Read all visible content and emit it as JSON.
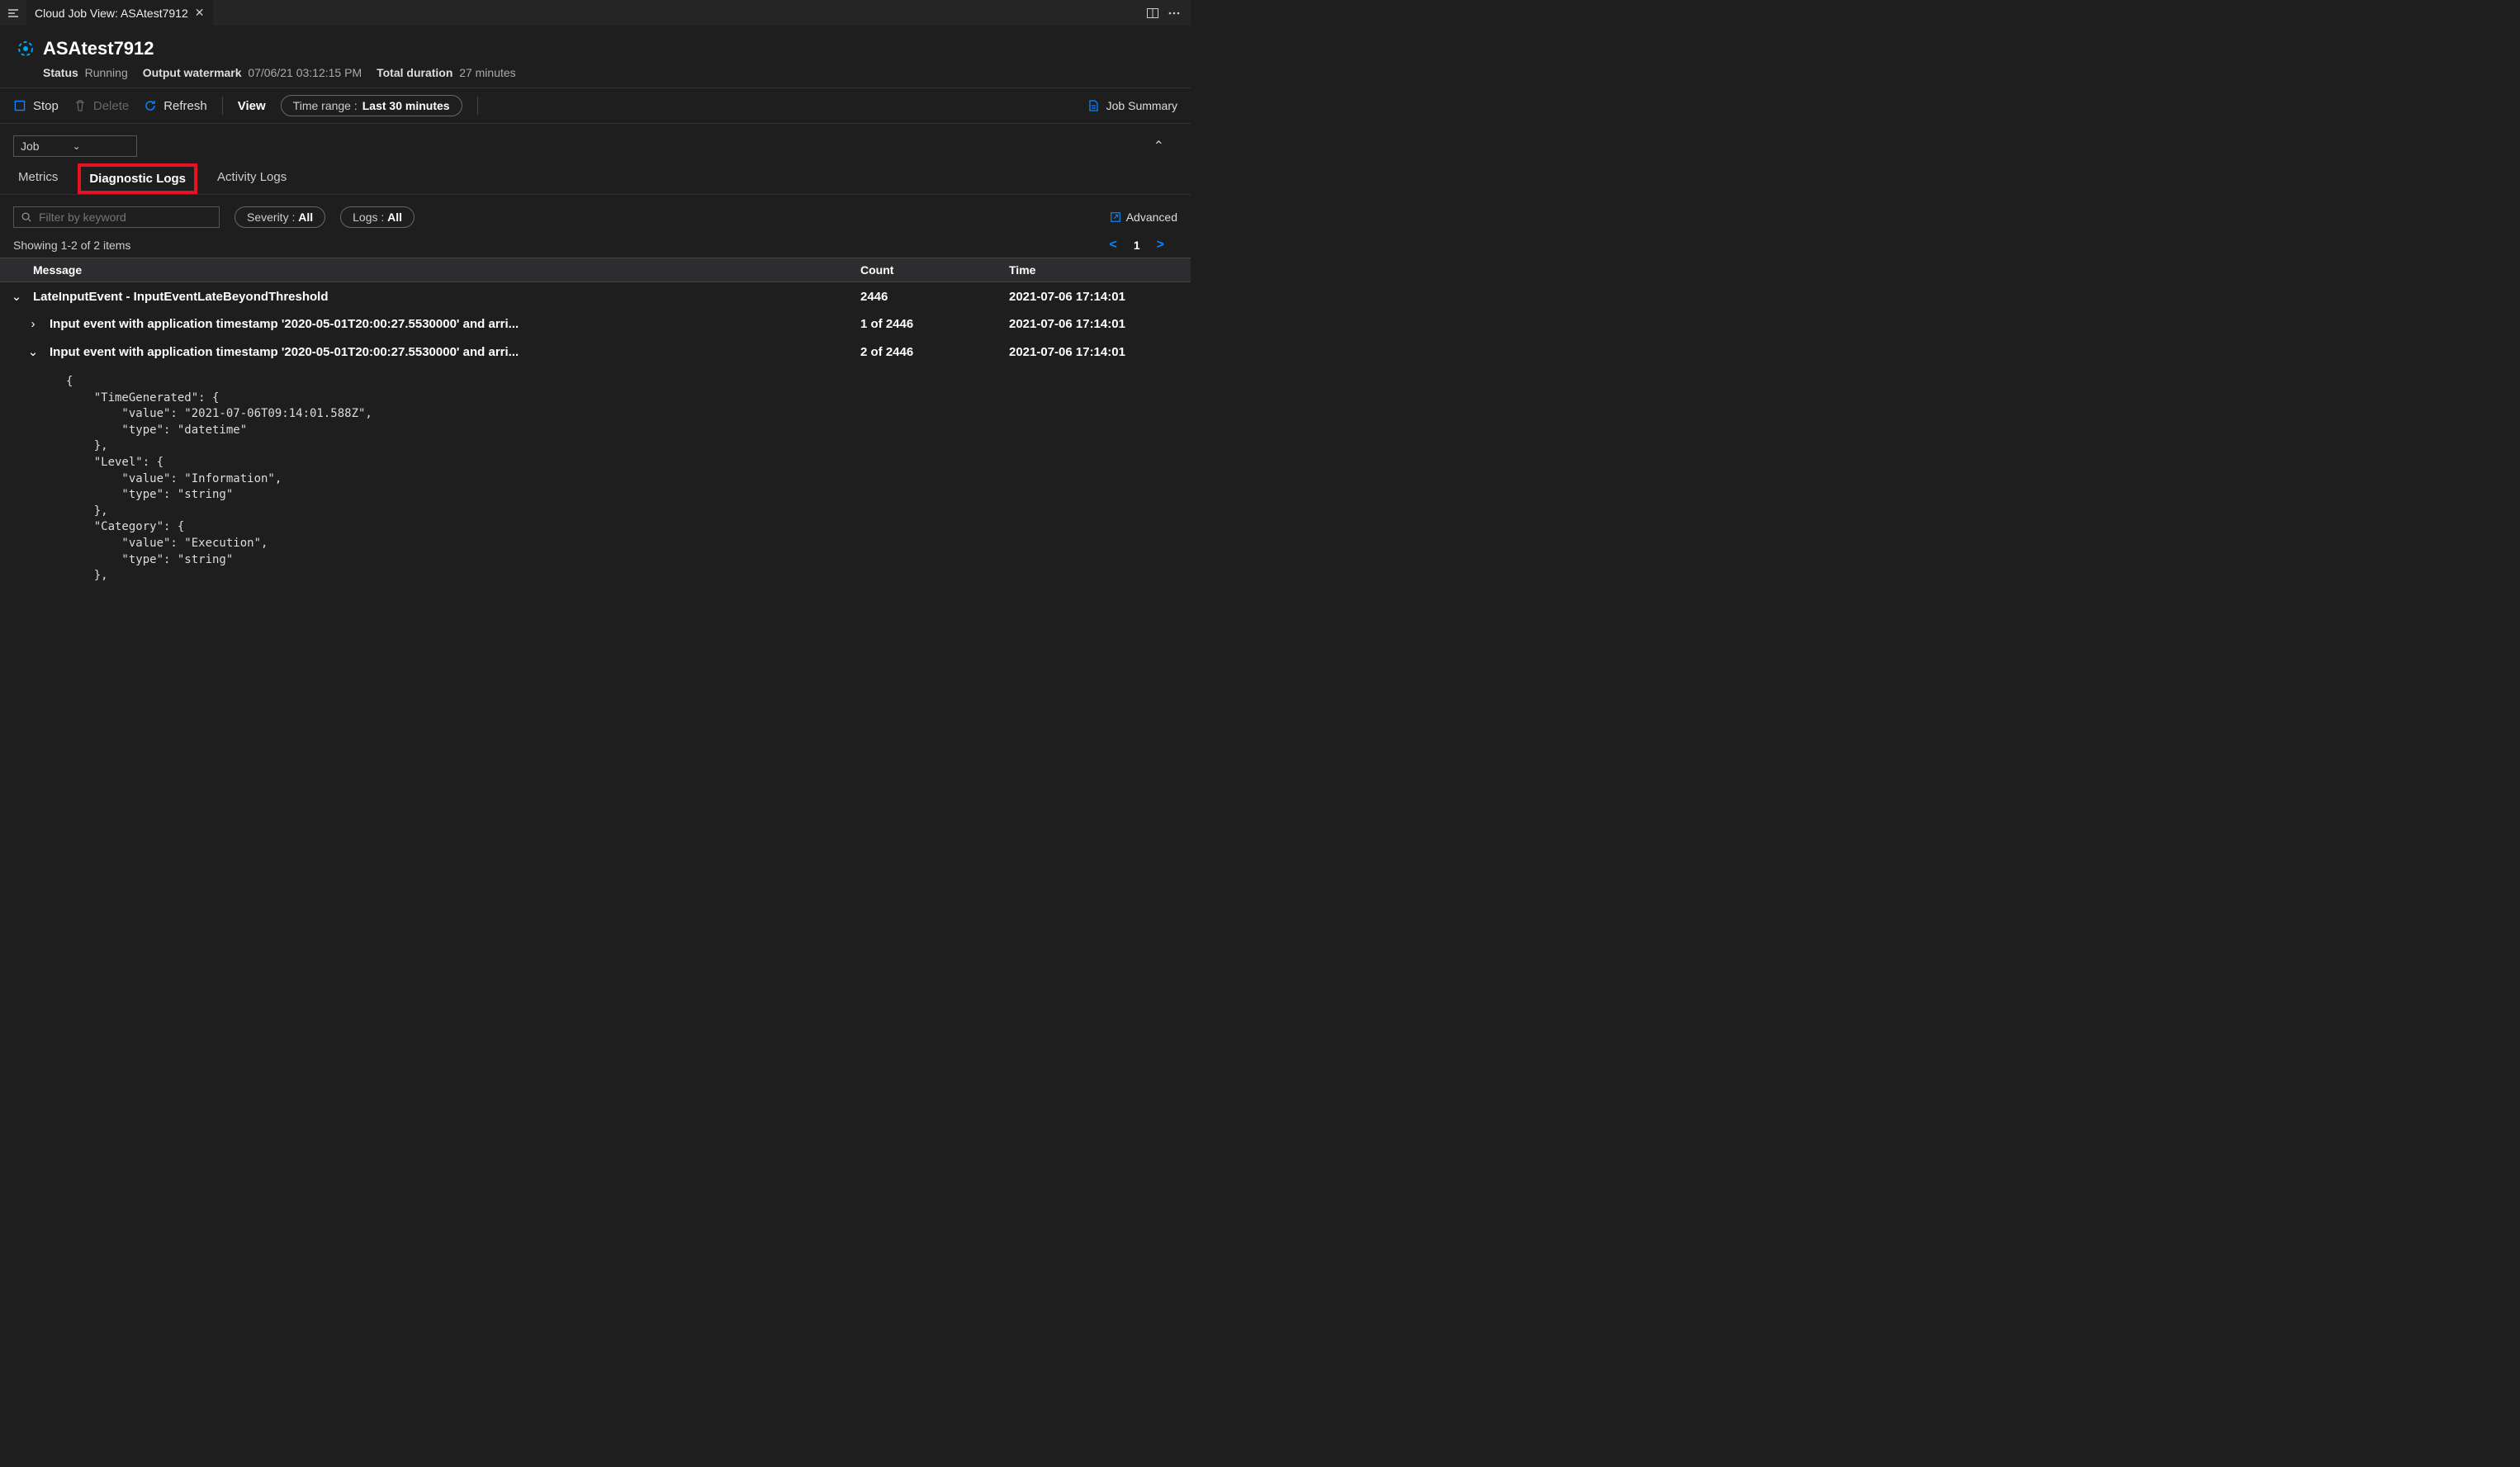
{
  "tab": {
    "title": "Cloud Job View: ASAtest7912"
  },
  "header": {
    "jobName": "ASAtest7912",
    "statusLabel": "Status",
    "statusValue": "Running",
    "watermarkLabel": "Output watermark",
    "watermarkValue": "07/06/21 03:12:15 PM",
    "durationLabel": "Total duration",
    "durationValue": "27 minutes"
  },
  "toolbar": {
    "stop": "Stop",
    "delete": "Delete",
    "refresh": "Refresh",
    "view": "View",
    "timeRangeLabel": "Time range :",
    "timeRangeValue": "Last 30 minutes",
    "jobSummary": "Job Summary"
  },
  "scope": {
    "label": "Job"
  },
  "tabs": {
    "metrics": "Metrics",
    "diag": "Diagnostic Logs",
    "activity": "Activity Logs"
  },
  "filters": {
    "placeholder": "Filter by keyword",
    "severityLabel": "Severity :",
    "severityValue": "All",
    "logsLabel": "Logs :",
    "logsValue": "All",
    "advanced": "Advanced"
  },
  "results": {
    "summary": "Showing 1-2 of 2 items",
    "page": "1"
  },
  "columns": {
    "message": "Message",
    "count": "Count",
    "time": "Time"
  },
  "rows": [
    {
      "message": "LateInputEvent - InputEventLateBeyondThreshold",
      "count": "2446",
      "time": "2021-07-06 17:14:01",
      "expanded": true
    },
    {
      "message": "Input event with application timestamp '2020-05-01T20:00:27.5530000' and arri...",
      "count": "1 of 2446",
      "time": "2021-07-06 17:14:01",
      "expanded": false,
      "level": 1
    },
    {
      "message": "Input event with application timestamp '2020-05-01T20:00:27.5530000' and arri...",
      "count": "2 of 2446",
      "time": "2021-07-06 17:14:01",
      "expanded": true,
      "level": 1
    }
  ],
  "jsonDetail": "{\n    \"TimeGenerated\": {\n        \"value\": \"2021-07-06T09:14:01.588Z\",\n        \"type\": \"datetime\"\n    },\n    \"Level\": {\n        \"value\": \"Information\",\n        \"type\": \"string\"\n    },\n    \"Category\": {\n        \"value\": \"Execution\",\n        \"type\": \"string\"\n    },"
}
